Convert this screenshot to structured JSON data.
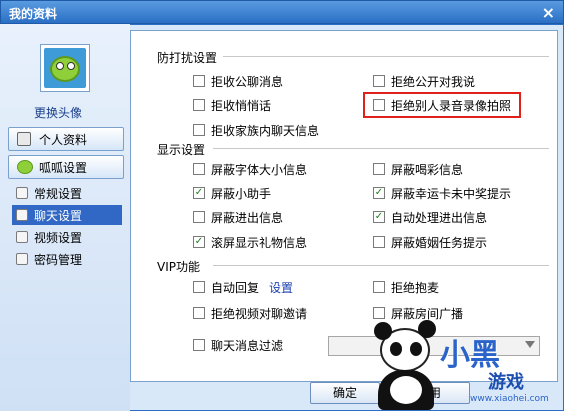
{
  "window": {
    "title": "我的资料",
    "close_label": "×"
  },
  "sidebar": {
    "change_avatar": "更换头像",
    "nav": [
      {
        "label": "个人资料",
        "icon": "id-card-icon"
      },
      {
        "label": "呱呱设置",
        "icon": "frog-icon"
      }
    ],
    "sub": [
      {
        "label": "常规设置",
        "icon": "settings-icon",
        "active": false
      },
      {
        "label": "聊天设置",
        "icon": "chat-icon",
        "active": true
      },
      {
        "label": "视频设置",
        "icon": "video-icon",
        "active": false
      },
      {
        "label": "密码管理",
        "icon": "key-icon",
        "active": false
      }
    ]
  },
  "sections": {
    "anti_disturb": {
      "title": "防打扰设置",
      "options": [
        {
          "label": "拒收公聊消息",
          "checked": false
        },
        {
          "label": "拒绝公开对我说",
          "checked": false
        },
        {
          "label": "拒收悄悄话",
          "checked": false
        },
        {
          "label": "拒绝别人录音录像拍照",
          "checked": false
        },
        {
          "label": "拒收家族内聊天信息",
          "checked": false
        }
      ]
    },
    "display": {
      "title": "显示设置",
      "options": [
        {
          "label": "屏蔽字体大小信息",
          "checked": false
        },
        {
          "label": "屏蔽喝彩信息",
          "checked": false
        },
        {
          "label": "屏蔽小助手",
          "checked": true
        },
        {
          "label": "屏蔽幸运卡未中奖提示",
          "checked": true
        },
        {
          "label": "屏蔽进出信息",
          "checked": false
        },
        {
          "label": "自动处理进出信息",
          "checked": true
        },
        {
          "label": "滚屏显示礼物信息",
          "checked": true
        },
        {
          "label": "屏蔽婚姻任务提示",
          "checked": false
        }
      ]
    },
    "vip": {
      "title": "VIP功能",
      "options": [
        {
          "label": "自动回复",
          "checked": false,
          "link": "设置"
        },
        {
          "label": "拒绝抱麦",
          "checked": false
        },
        {
          "label": "拒绝视频对聊邀请",
          "checked": false
        },
        {
          "label": "屏蔽房间广播",
          "checked": false
        },
        {
          "label": "聊天消息过滤",
          "checked": false
        }
      ],
      "filter_select_value": ""
    }
  },
  "buttons": {
    "ok": "确定",
    "apply_partial": "用"
  },
  "watermark": {
    "line1": "小黑",
    "line2": "游戏",
    "url": "www.xiaohei.com"
  },
  "colors": {
    "title_bar": "#2a6fc5",
    "highlight": "#e0201a",
    "active_nav": "#3168c5"
  }
}
